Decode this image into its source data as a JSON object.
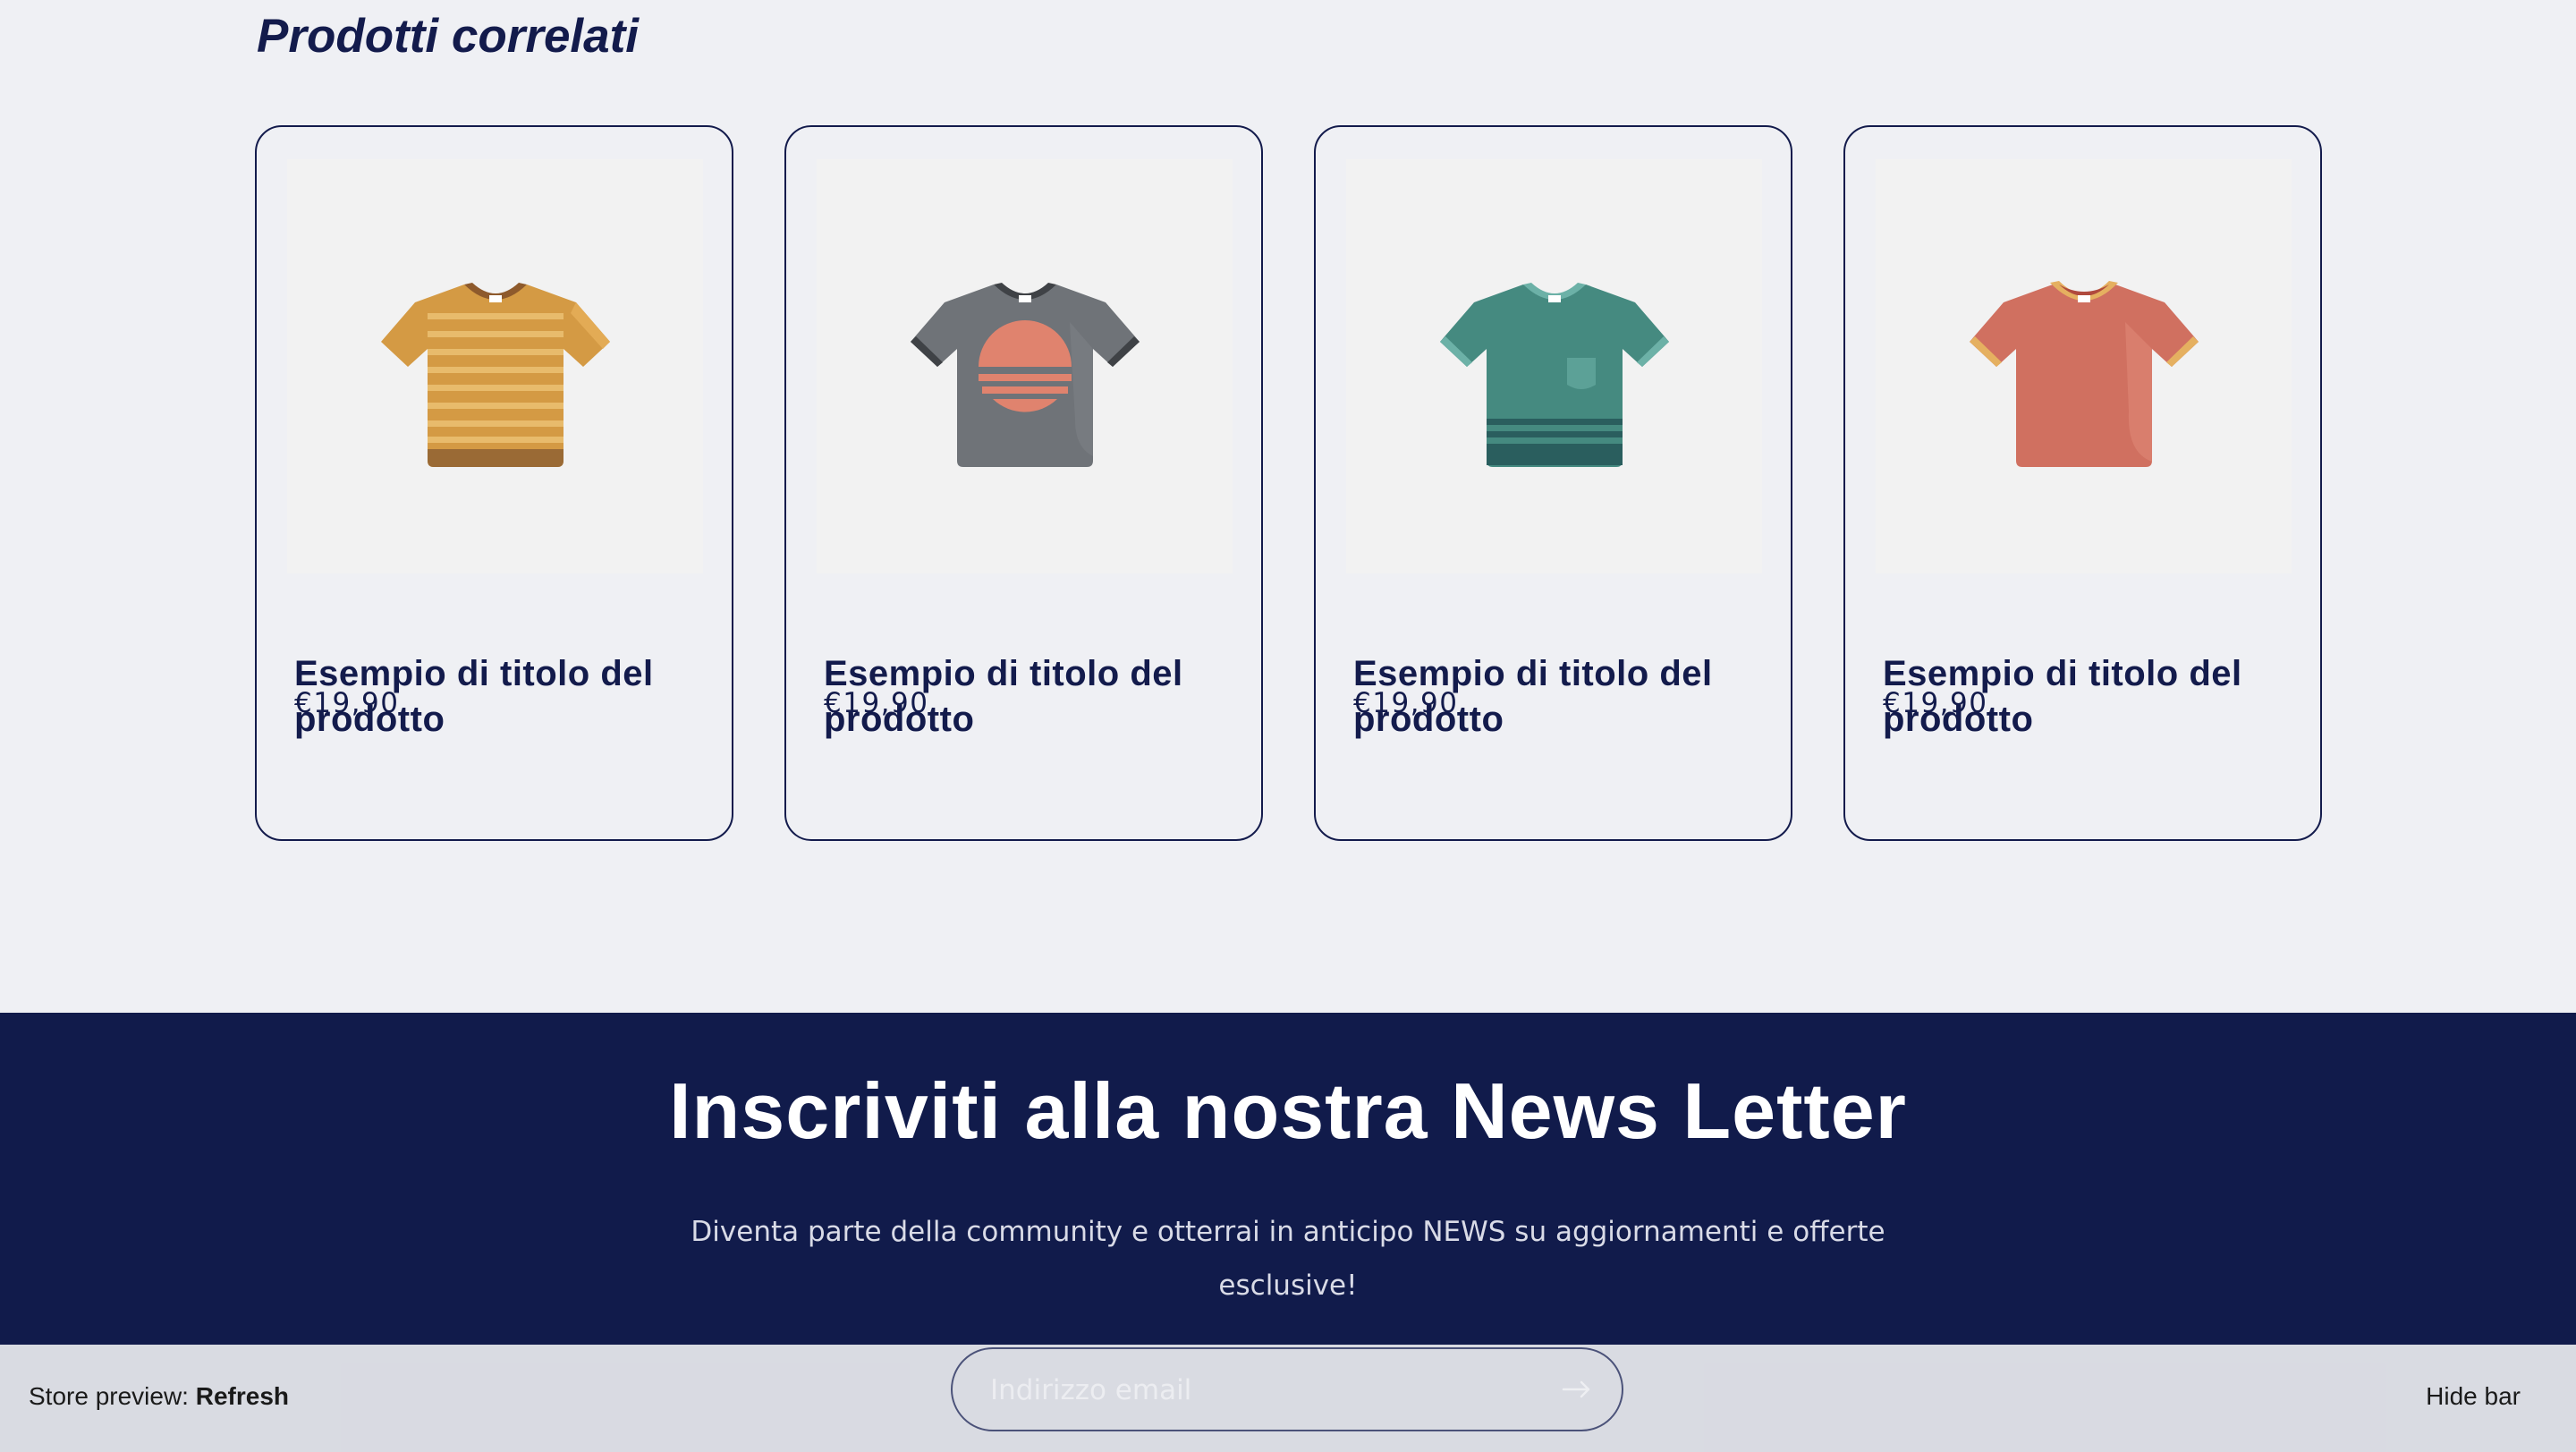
{
  "related": {
    "title": "Prodotti correlati",
    "products": [
      {
        "title": "Esempio di titolo del prodotto",
        "price": "€19,90",
        "image_icon": "tshirt-striped-yellow-icon",
        "color": "#d49a44"
      },
      {
        "title": "Esempio di titolo del prodotto",
        "price": "€19,90",
        "image_icon": "tshirt-gray-sunset-icon",
        "color": "#6f7378"
      },
      {
        "title": "Esempio di titolo del prodotto",
        "price": "€19,90",
        "image_icon": "tshirt-teal-pocket-icon",
        "color": "#458a80"
      },
      {
        "title": "Esempio di titolo del prodotto",
        "price": "€19,90",
        "image_icon": "tshirt-coral-icon",
        "color": "#d07060"
      }
    ]
  },
  "newsletter": {
    "heading": "Inscriviti alla nostra News Letter",
    "description": "Diventa parte della community e otterrai in anticipo NEWS su aggiornamenti e offerte esclusive!",
    "email_placeholder": "Indirizzo email",
    "submit_icon": "arrow-right-icon",
    "background": "#111b4b"
  },
  "preview_bar": {
    "label": "Store preview:",
    "refresh": "Refresh",
    "hide": "Hide bar"
  },
  "colors": {
    "accent": "#131b4c",
    "page_bg": "#eff0f4"
  }
}
